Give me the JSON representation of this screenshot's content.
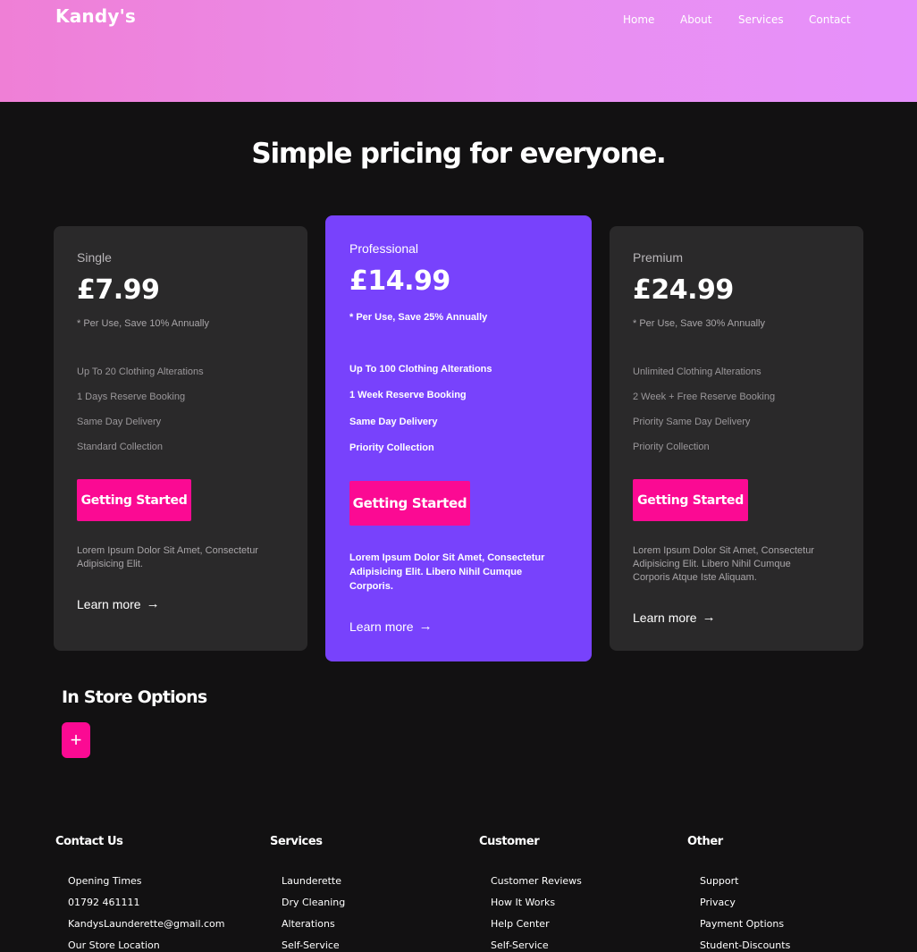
{
  "brand": {
    "logo": "Kandy's"
  },
  "nav": {
    "items": [
      "Home",
      "About",
      "Services",
      "Contact"
    ]
  },
  "pricing": {
    "headline": "Simple pricing for everyone.",
    "plans": [
      {
        "name": "Single",
        "price": "£7.99",
        "note": "* Per Use, Save 10% Annually",
        "features": [
          "Up To 20 Clothing Alterations",
          "1 Days Reserve Booking",
          "Same Day Delivery",
          "Standard Collection"
        ],
        "cta": "Getting Started",
        "desc_lines": [
          "Lorem Ipsum Dolor Sit Amet, Consectetur",
          "Adipisicing Elit."
        ],
        "learn": "Learn more"
      },
      {
        "name": "Professional",
        "price": "£14.99",
        "note": "* Per Use, Save 25% Annually",
        "features": [
          "Up To 100 Clothing Alterations",
          "1 Week Reserve Booking",
          "Same Day Delivery",
          "Priority Collection"
        ],
        "cta": "Getting Started",
        "desc_lines": [
          "Lorem Ipsum Dolor Sit Amet, Consectetur",
          "Adipisicing Elit. Libero Nihil Cumque",
          "Corporis."
        ],
        "learn": "Learn more"
      },
      {
        "name": "Premium",
        "price": "£24.99",
        "note": "* Per Use, Save 30% Annually",
        "features": [
          "Unlimited Clothing Alterations",
          "2 Week + Free Reserve Booking",
          "Priority Same Day Delivery",
          "Priority Collection"
        ],
        "cta": "Getting Started",
        "desc_lines": [
          "Lorem Ipsum Dolor Sit Amet, Consectetur",
          "Adipisicing Elit. Libero Nihil Cumque",
          "Corporis Atque Iste Aliquam."
        ],
        "learn": "Learn more"
      }
    ]
  },
  "store": {
    "title": "In Store Options",
    "expand_glyph": "+"
  },
  "footer": {
    "columns": [
      {
        "title": "Contact Us",
        "items": [
          "Opening Times",
          "01792 461111",
          "KandysLaunderette@gmail.com",
          "Our Store Location"
        ]
      },
      {
        "title": "Services",
        "items": [
          "Launderette",
          "Dry Cleaning",
          "Alterations",
          "Self-Service"
        ]
      },
      {
        "title": "Customer",
        "items": [
          "Customer Reviews",
          "How It Works",
          "Help Center",
          "Self-Service"
        ]
      },
      {
        "title": "Other",
        "items": [
          "Support",
          "Privacy",
          "Payment Options",
          "Student-Discounts"
        ]
      }
    ]
  },
  "icons": {
    "learn_more": "arrow-right-icon",
    "expand": "plus-icon"
  },
  "colors": {
    "accent": "#fb0a93",
    "featured": "#7842fc",
    "card": "#2a292a",
    "background": "#121112"
  }
}
